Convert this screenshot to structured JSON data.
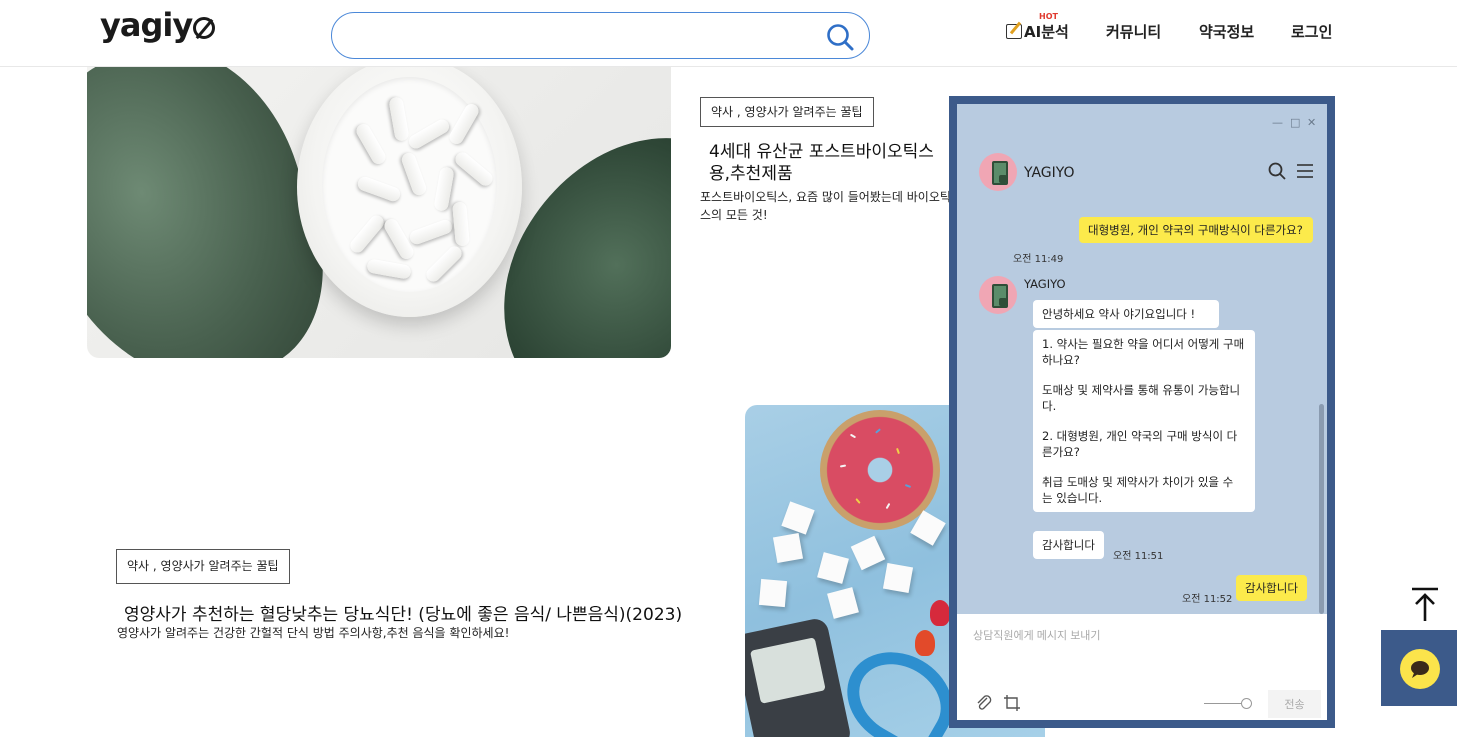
{
  "header": {
    "logo": "yagiy",
    "search_placeholder": "",
    "nav": {
      "ai_hot": "HOT",
      "ai_label": "AI분석",
      "community": "커뮤니티",
      "pharmacy_info": "약국정보",
      "login": "로그인"
    }
  },
  "articles": [
    {
      "tag": "약사 , 영양사가 알려주는 꿀팁",
      "title": "4세대 유산균 포스트바이오틱스 용,추천제품",
      "description": "포스트바이오틱스, 요즘 많이 들어봤는데 바이오틱스의 모든 것!"
    },
    {
      "tag": "약사 , 영양사가 알려주는 꿀팁",
      "title": "영양사가 추천하는 혈당낮추는 당뇨식단! (당뇨에 좋은 음식/ 나쁜음식)(2023)",
      "description": "영양사가 알려주는 건강한 간헐적 단식 방법 주의사항,추천 음식을 확인하세요!"
    }
  ],
  "chat": {
    "window_controls": {
      "minimize": "—",
      "maximize": "□",
      "close": "✕"
    },
    "title": "YAGIYO",
    "messages": {
      "user_1": {
        "text": "대형병원, 개인 약국의 구매방식이 다른가요?",
        "time": "오전 11:49"
      },
      "bot_sender": "YAGIYO",
      "bot_1": "안녕하세요 약사 야기요입니다 !",
      "bot_2": {
        "line1": "1. 약사는 필요한 약을 어디서 어떻게 구매하나요?",
        "line2": "도매상 및 제약사를 통해 유통이 가능합니다.",
        "line3": "2. 대형병원, 개인 약국의 구매 방식이 다른가요?",
        "line4": "취급 도매상 및 제약사가 차이가 있을 수 는 있습니다."
      },
      "bot_3": {
        "text": "감사합니다",
        "time": "오전 11:51"
      },
      "user_2": {
        "text": "감사합니다",
        "time": "오전 11:52"
      }
    },
    "input_placeholder": "상담직원에게 메시지 보내기",
    "send_label": "전송"
  },
  "floating": {
    "top_icon": "arrow-up-to-top-icon",
    "chat_icon": "chat-bubble-icon"
  },
  "colors": {
    "search_border": "#4b88d8",
    "chat_frame": "#3c5a8a",
    "chat_bg": "#b8cbe0",
    "my_bubble": "#fcea4b",
    "hot": "#e03a2f"
  }
}
